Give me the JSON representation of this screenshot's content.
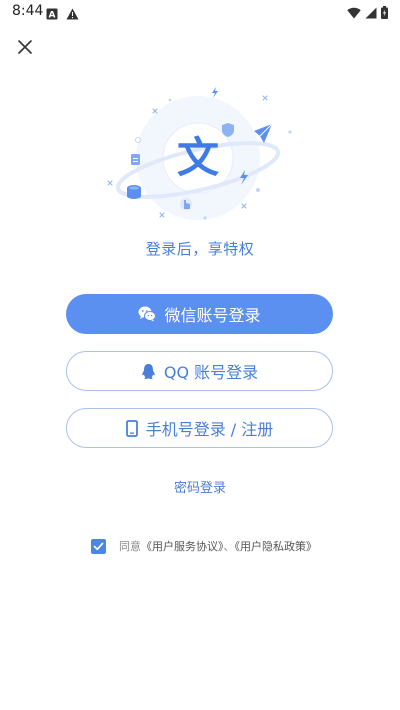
{
  "status_bar": {
    "time": "8:44",
    "left_icons": [
      "notification-a-icon",
      "warning-icon"
    ],
    "right_icons": [
      "wifi-icon",
      "signal-icon",
      "battery-icon"
    ]
  },
  "header": {
    "close_icon": "close-icon"
  },
  "hero": {
    "logo_char": "文",
    "accent": "#4a7fd8"
  },
  "tagline": "登录后，享特权",
  "buttons": {
    "wechat": {
      "label": "微信账号登录",
      "icon": "wechat-icon"
    },
    "qq": {
      "label": "QQ 账号登录",
      "icon": "qq-icon"
    },
    "phone": {
      "label": "手机号登录 / 注册",
      "icon": "phone-icon"
    }
  },
  "password_login": "密码登录",
  "agreement": {
    "checked": true,
    "prefix": "同意",
    "terms": "《用户服务协议》",
    "separator": "、",
    "privacy": "《用户隐私政策》"
  },
  "colors": {
    "primary": "#5b8ff0",
    "accent_text": "#4a7fd8",
    "outline": "#a9c3ee"
  }
}
